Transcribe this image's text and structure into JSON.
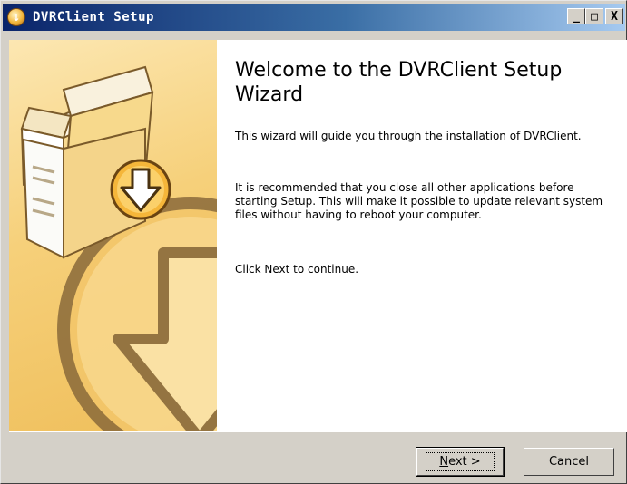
{
  "window": {
    "title": "DVRClient Setup",
    "controls": {
      "minimize": "_",
      "maximize": "□",
      "close": "X"
    }
  },
  "main": {
    "heading": "Welcome to the DVRClient Setup Wizard",
    "paragraphs": [
      "This wizard will guide you through the installation of DVRClient.",
      "It is recommended that you close all other applications before starting Setup. This will make it possible to update relevant system files without having to reboot your computer.",
      "Click Next to continue."
    ]
  },
  "footer": {
    "next_label_prefix": "N",
    "next_label_rest": "ext >",
    "cancel_label": "Cancel"
  },
  "colors": {
    "titlebar_start": "#0a246a",
    "titlebar_end": "#a6caf0",
    "banner": "#f6d07a"
  }
}
